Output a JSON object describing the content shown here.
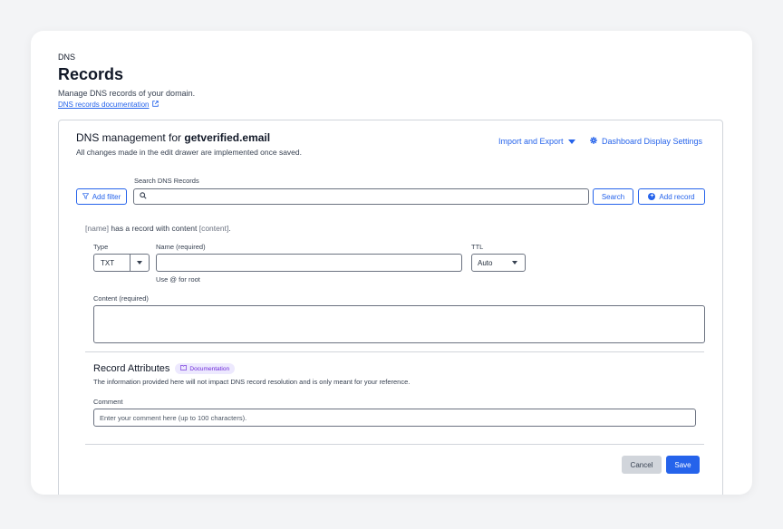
{
  "header": {
    "breadcrumb": "DNS",
    "title": "Records",
    "subtitle": "Manage DNS records of your domain.",
    "doc_link": "DNS records documentation",
    "doc_link_icon": "external-link-icon"
  },
  "panel": {
    "management_prefix": "DNS management for ",
    "domain": "getverified.email",
    "management_note": "All changes made in the edit drawer are implemented once saved.",
    "import_export_label": "Import and Export",
    "dashboard_settings_label": "Dashboard Display Settings"
  },
  "search": {
    "add_filter_label": "Add filter",
    "label": "Search DNS Records",
    "value": "",
    "search_button_label": "Search",
    "add_record_label": "Add record"
  },
  "record_form": {
    "hint_name": "[name]",
    "hint_middle": " has a record with content ",
    "hint_content": "[content]",
    "hint_end": ".",
    "type_label": "Type",
    "type_value": "TXT",
    "name_label": "Name (required)",
    "name_value": "",
    "name_helper": "Use @ for root",
    "ttl_label": "TTL",
    "ttl_value": "Auto",
    "content_label": "Content (required)",
    "content_value": ""
  },
  "attributes": {
    "title": "Record Attributes",
    "badge_label": "Documentation",
    "description": "The information provided here will not impact DNS record resolution and is only meant for your reference.",
    "comment_label": "Comment",
    "comment_placeholder": "Enter your comment here (up to 100 characters)."
  },
  "actions": {
    "cancel_label": "Cancel",
    "save_label": "Save"
  },
  "colors": {
    "accent": "#2563eb",
    "badge_bg": "#ede9fe",
    "badge_text": "#6d28d9"
  }
}
